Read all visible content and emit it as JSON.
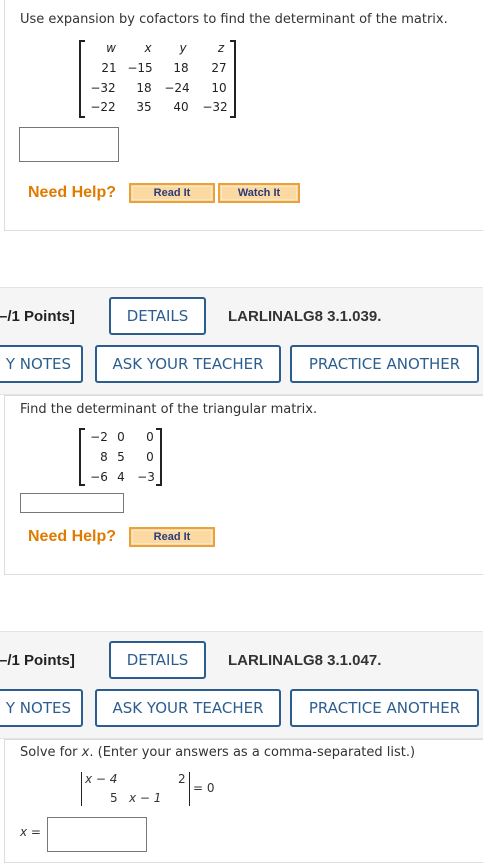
{
  "q1": {
    "prompt": "Use expansion by cofactors to find the determinant of the matrix.",
    "headers": [
      "w",
      "x",
      "y",
      "z"
    ],
    "rows": [
      [
        "21",
        "−15",
        "18",
        "27"
      ],
      [
        "−32",
        "18",
        "−24",
        "10"
      ],
      [
        "−22",
        "35",
        "40",
        "−32"
      ]
    ],
    "need_help": "Need Help?",
    "read_it": "Read It",
    "watch_it": "Watch It"
  },
  "q2": {
    "points": "[–/1 Points]",
    "details": "DETAILS",
    "code": "LARLINALG8 3.1.039.",
    "my_notes": "Y NOTES",
    "ask_teacher": "ASK YOUR TEACHER",
    "practice_another": "PRACTICE ANOTHER",
    "prompt": "Find the determinant of the triangular matrix.",
    "rows": [
      [
        "−2",
        "0",
        "0"
      ],
      [
        "8",
        "5",
        "0"
      ],
      [
        "−6",
        "4",
        "−3"
      ]
    ],
    "need_help": "Need Help?",
    "read_it": "Read It"
  },
  "q3": {
    "points": "[–/1 Points]",
    "details": "DETAILS",
    "code": "LARLINALG8 3.1.047.",
    "my_notes": "Y NOTES",
    "ask_teacher": "ASK YOUR TEACHER",
    "practice_another": "PRACTICE ANOTHER",
    "prompt_before": "Solve for ",
    "prompt_var": "x",
    "prompt_after": ". (Enter your answers as a comma-separated list.)",
    "det": {
      "r1c1": "x − 4",
      "r1c2": "2",
      "r2c1": "5",
      "r2c2": "x − 1"
    },
    "equals_zero": "= 0",
    "answer_label": "x ="
  }
}
